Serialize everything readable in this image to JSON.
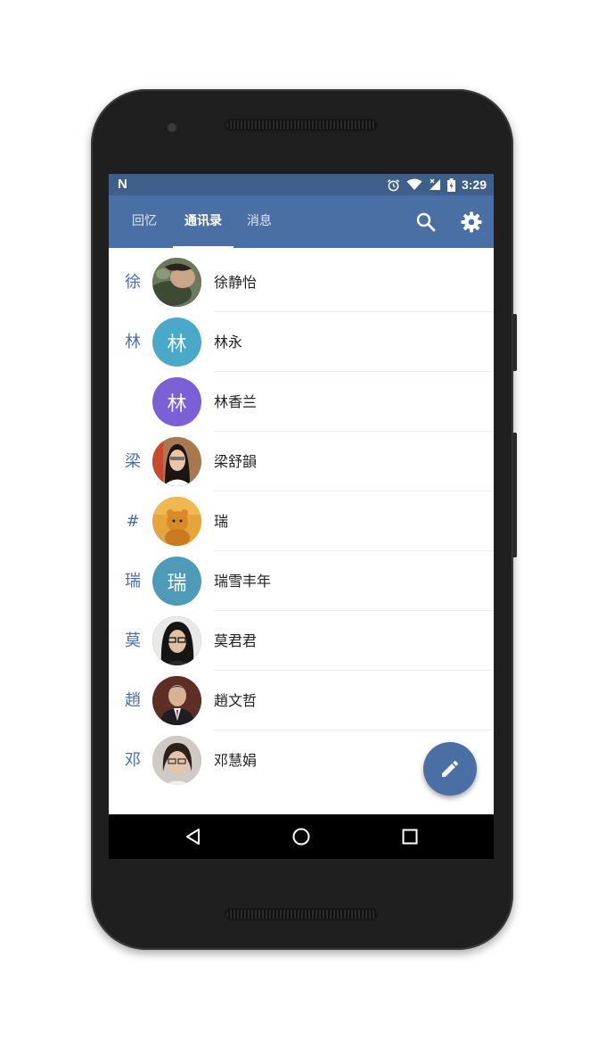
{
  "status_bar": {
    "notification_icon": "N",
    "time": "3:29",
    "icons": [
      "alarm-icon",
      "wifi-icon",
      "signal-icon",
      "battery-icon"
    ]
  },
  "app_bar": {
    "tabs": [
      {
        "label": "回忆",
        "active": false
      },
      {
        "label": "通讯录",
        "active": true
      },
      {
        "label": "消息",
        "active": false
      }
    ],
    "actions": [
      "search-icon",
      "gear-icon"
    ],
    "color": "#4a6fa5"
  },
  "contacts": [
    {
      "index": "徐",
      "name": "徐静怡",
      "avatar_text": "",
      "avatar_color": "#5a6f4e"
    },
    {
      "index": "林",
      "name": "林永",
      "avatar_text": "林",
      "avatar_color": "#4aa9c8"
    },
    {
      "index": "",
      "name": "林香兰",
      "avatar_text": "林",
      "avatar_color": "#7a5fd6"
    },
    {
      "index": "梁",
      "name": "梁舒韻",
      "avatar_text": "",
      "avatar_color": "#8a6a4a"
    },
    {
      "index": "#",
      "name": "瑞",
      "avatar_text": "",
      "avatar_color": "#e0a23a"
    },
    {
      "index": "瑞",
      "name": "瑞雪丰年",
      "avatar_text": "瑞",
      "avatar_color": "#4d9bb8"
    },
    {
      "index": "莫",
      "name": "莫君君",
      "avatar_text": "",
      "avatar_color": "#3a3a3a"
    },
    {
      "index": "趙",
      "name": "趙文哲",
      "avatar_text": "",
      "avatar_color": "#4a2e28"
    },
    {
      "index": "邓",
      "name": "邓慧娟",
      "avatar_text": "",
      "avatar_color": "#b9b3ad"
    }
  ],
  "fab": {
    "icon": "pencil-icon"
  },
  "nav_bar": {
    "icons": [
      "back-icon",
      "home-icon",
      "recents-icon"
    ]
  }
}
